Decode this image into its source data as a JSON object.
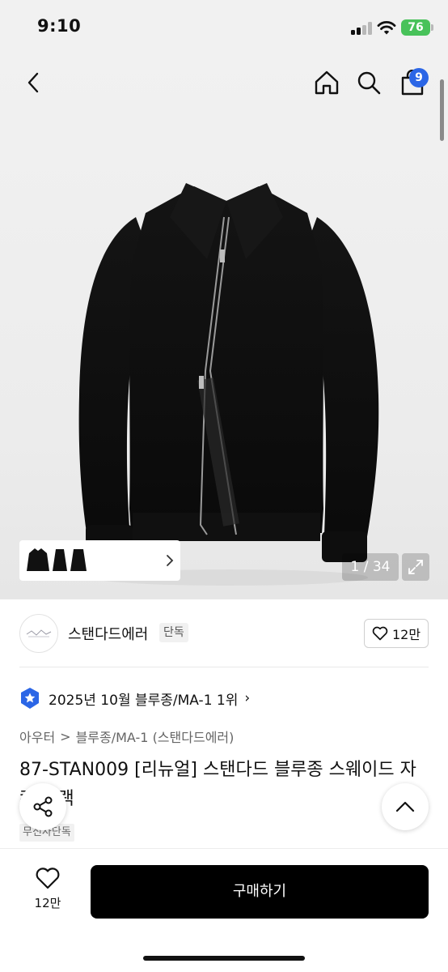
{
  "status_bar": {
    "time": "9:10",
    "battery": "76",
    "icons": [
      "signal-icon",
      "wifi-icon",
      "battery-icon"
    ]
  },
  "top_nav": {
    "icons": [
      "back-arrow-icon",
      "home-icon",
      "search-icon",
      "shopping-bag-icon"
    ],
    "cart_count": "9"
  },
  "gallery": {
    "page_counter": "1 / 34",
    "icons": [
      "chevron-right-icon",
      "expand-icon"
    ]
  },
  "brand": {
    "name": "스탠다드에러",
    "tag": "단독",
    "like_count": "12만",
    "icons": [
      "heart-icon"
    ]
  },
  "ranking": {
    "text": "2025년 10월 블루종/MA-1 1위",
    "chevron": "›",
    "icons": [
      "star-badge-icon"
    ]
  },
  "category": {
    "primary": "아우터",
    "separator": ">",
    "secondary": "블루종/MA-1 (스탠다드에러)"
  },
  "product": {
    "title": "87-STAN009 [리뉴얼] 스탠다드 블루종 스웨이드 자켓 블랙",
    "exclusive_tag": "무신사단독"
  },
  "floating": {
    "icons": [
      "share-icon",
      "chevron-up-icon"
    ]
  },
  "bottom_bar": {
    "like_count": "12만",
    "buy_label": "구매하기",
    "icons": [
      "heart-icon"
    ]
  },
  "colors": {
    "cart_badge": "#2b66e6",
    "rank_badge": "#2b66e6",
    "battery": "#48c25a",
    "buy_button": "#000000"
  }
}
